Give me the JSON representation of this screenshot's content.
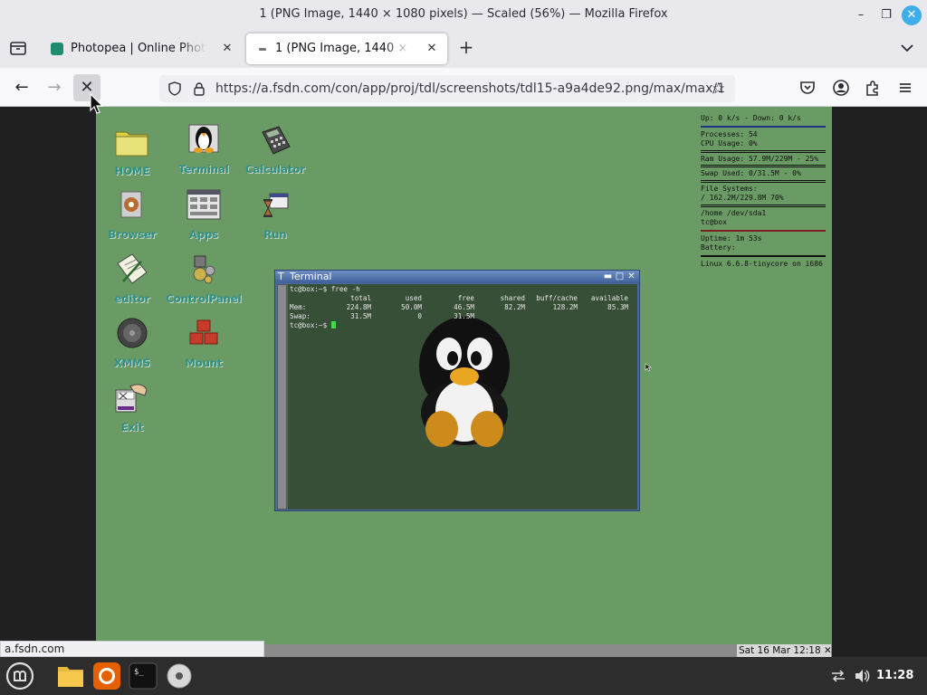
{
  "window": {
    "title": "1 (PNG Image, 1440 × 1080 pixels) — Scaled (56%) — Mozilla Firefox",
    "min_glyph": "–",
    "max_glyph": "❐",
    "close_glyph": "✕"
  },
  "tabs": [
    {
      "label": "Photopea | Online Photo Editor",
      "close": "✕"
    },
    {
      "label": "1 (PNG Image, 1440 × 1080 pixels)",
      "close": "✕"
    }
  ],
  "newtab_glyph": "+",
  "nav": {
    "back_glyph": "←",
    "forward_glyph": "→",
    "stop_glyph": "✕",
    "url": "https://a.fsdn.com/con/app/proj/tdl/screenshots/tdl15-a9a4de92.png/max/max/1",
    "bookmark_glyph": "☆"
  },
  "desktop_icons": [
    {
      "label": "HOME",
      "icon": "folder-icon"
    },
    {
      "label": "Terminal",
      "icon": "tux-terminal-icon"
    },
    {
      "label": "Calculator",
      "icon": "calculator-icon"
    },
    {
      "label": "Browser",
      "icon": "browser-icon"
    },
    {
      "label": "Apps",
      "icon": "apps-icon"
    },
    {
      "label": "Run",
      "icon": "run-icon"
    },
    {
      "label": "editor",
      "icon": "editor-icon"
    },
    {
      "label": "ControlPanel",
      "icon": "control-panel-icon"
    },
    {
      "label": "XMMS",
      "icon": "xmms-icon"
    },
    {
      "label": "Mount",
      "icon": "mount-icon"
    },
    {
      "label": "Exit",
      "icon": "exit-icon"
    }
  ],
  "conky": {
    "net": "Up: 0 k/s - Down: 0 k/s",
    "processes": "Processes: 54",
    "cpu": "CPU Usage: 0%",
    "ram": "Ram Usage: 57.9M/229M - 25%",
    "swap": "Swap Used: 0/31.5M - 0%",
    "fs_label": "File Systems:",
    "fs": "/ 162.2M/229.8M 70%",
    "home": "/home  /dev/sda1",
    "home2": "tc@box",
    "uptime": "Uptime:  1m 53s",
    "battery": "Battery:",
    "kernel": "Linux 6.6.8-tinycore on i686"
  },
  "terminal": {
    "title": "Terminal",
    "menu_glyph": "T",
    "lines": {
      "cmd": "tc@box:~$ free -h",
      "prompt": "tc@box:~$ "
    },
    "headers": [
      "total",
      "used",
      "free",
      "shared",
      "buff/cache",
      "available"
    ],
    "rows": [
      {
        "label": "Mem:",
        "values": [
          "224.8M",
          "50.0M",
          "46.5M",
          "82.2M",
          "128.2M",
          "85.3M"
        ]
      },
      {
        "label": "Swap:",
        "values": [
          "31.5M",
          "0",
          "31.5M",
          "",
          "",
          ""
        ]
      }
    ]
  },
  "vm_clock": "Sat 16 Mar 12:18 ✕",
  "status_link": "a.fsdn.com",
  "taskbar": {
    "clock": "11:28",
    "apps": [
      "mint-menu-icon",
      "files-icon",
      "firefox-icon",
      "terminal-icon",
      "disc-icon"
    ]
  },
  "colors": {
    "vm_background": "#6b9b64",
    "icon_label": "#2f8f89",
    "terminal_bg": "#374e37",
    "accent": "#3daee9"
  }
}
